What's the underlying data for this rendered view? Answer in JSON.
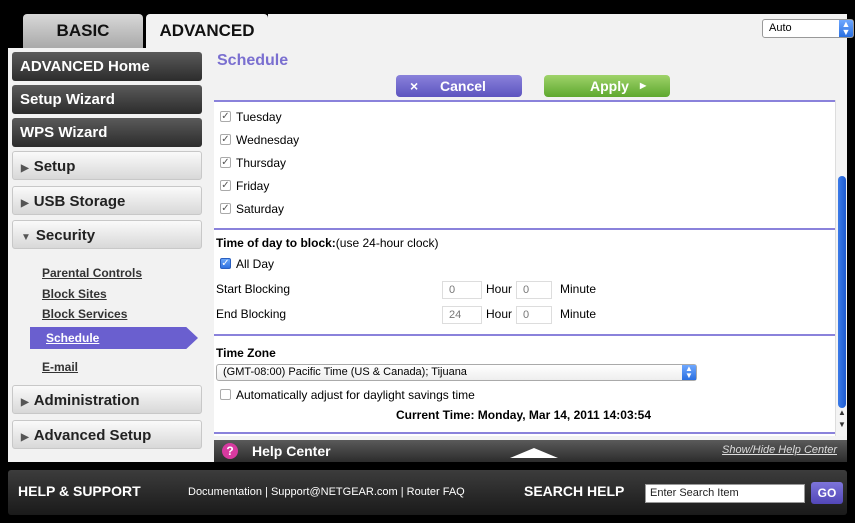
{
  "tabs": {
    "basic": "BASIC",
    "advanced": "ADVANCED"
  },
  "language_select": "Auto",
  "sidebar": {
    "advanced_home": "ADVANCED Home",
    "setup_wizard": "Setup Wizard",
    "wps_wizard": "WPS Wizard",
    "setup": "Setup",
    "usb_storage": "USB Storage",
    "security": "Security",
    "security_items": [
      "Parental Controls",
      "Block Sites",
      "Block Services",
      "Schedule",
      "E-mail"
    ],
    "administration": "Administration",
    "advanced_setup": "Advanced Setup"
  },
  "main": {
    "title": "Schedule",
    "cancel_label": "Cancel",
    "apply_label": "Apply",
    "days": [
      {
        "label": "Tuesday",
        "checked": true
      },
      {
        "label": "Wednesday",
        "checked": true
      },
      {
        "label": "Thursday",
        "checked": true
      },
      {
        "label": "Friday",
        "checked": true
      },
      {
        "label": "Saturday",
        "checked": true
      }
    ],
    "time_block_label": "Time of day to block:",
    "time_block_hint": "(use 24-hour clock)",
    "all_day": "All Day",
    "start_blocking": "Start Blocking",
    "end_blocking": "End Blocking",
    "start_hour": "0",
    "start_minute": "0",
    "end_hour": "24",
    "end_minute": "0",
    "hour_label": "Hour",
    "minute_label": "Minute",
    "time_zone_title": "Time Zone",
    "time_zone_value": "(GMT-08:00) Pacific Time (US & Canada); Tijuana",
    "dst_label": "Automatically adjust for daylight savings time",
    "current_time": "Current Time: Monday, Mar 14, 2011 14:03:54"
  },
  "help": {
    "title": "Help Center",
    "toggle": "Show/Hide Help Center"
  },
  "footer": {
    "help_support": "HELP & SUPPORT",
    "links": "Documentation | Support@NETGEAR.com | Router FAQ",
    "search_help": "SEARCH HELP",
    "search_value": "Enter Search Item",
    "go": "GO"
  },
  "colors": {
    "accent": "#7a6fd0",
    "apply_green": "#6db33f",
    "active_item": "#6a5fcf"
  }
}
